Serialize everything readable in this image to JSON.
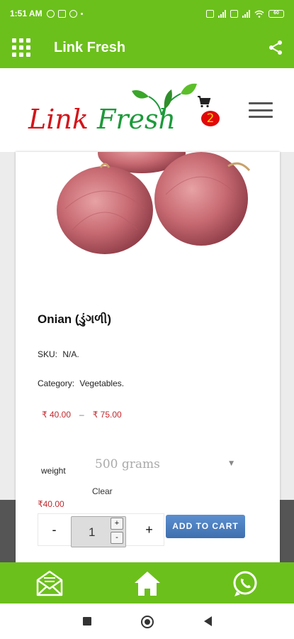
{
  "status_bar": {
    "time": "1:51 AM",
    "battery": "60",
    "icons_left": [
      "whatsapp-icon",
      "image-icon",
      "facebook-icon"
    ],
    "icons_right": [
      "volte-icon",
      "signal-icon",
      "volte-icon",
      "signal-icon",
      "wifi-icon",
      "battery-icon"
    ]
  },
  "app_bar": {
    "title": "Link Fresh",
    "menu_icon": "grid-icon",
    "action_icon": "share-icon"
  },
  "header": {
    "logo_text_1": "Link",
    "logo_text_2": "Fresh",
    "cart_count": "2"
  },
  "product": {
    "title": "Onian (ડુંગળી)",
    "sku_label": "SKU:",
    "sku_value": "N/A.",
    "category_label": "Category:",
    "category_value": "Vegetables.",
    "price_min": "₹ 40.00",
    "price_sep": "–",
    "price_max": "₹ 75.00",
    "weight_label": "weight",
    "weight_selected": "500 grams",
    "clear_label": "Clear",
    "variation_price": "₹40.00",
    "qty_minus": "-",
    "qty_value": "1",
    "qty_plus": "+",
    "spin_up": "+",
    "spin_down": "-",
    "add_to_cart": "ADD TO CART"
  },
  "bottom_nav": {
    "items": [
      "mail-icon",
      "home-icon",
      "whatsapp-icon"
    ]
  },
  "colors": {
    "brand_green": "#6cc01b",
    "price_red": "#c0282d",
    "badge_red": "#e2080a",
    "button_blue": "#4a7cbf"
  }
}
